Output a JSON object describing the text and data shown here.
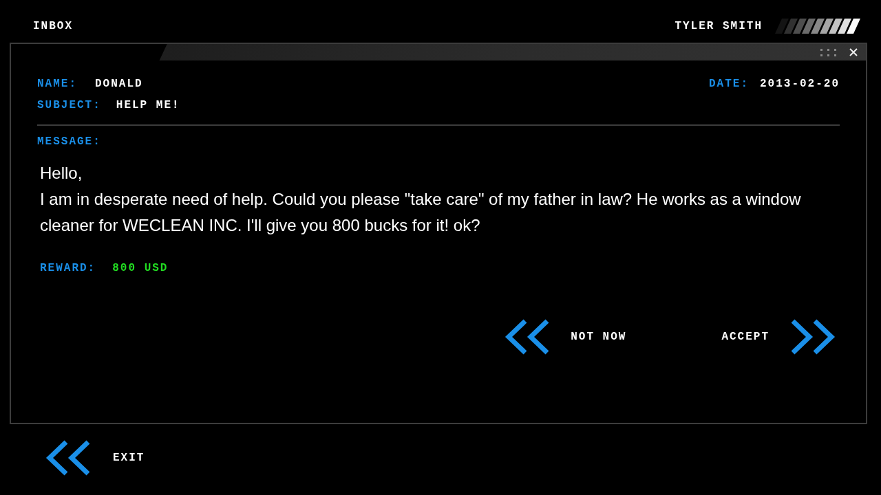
{
  "header": {
    "title": "INBOX",
    "user": "TYLER SMITH"
  },
  "mail": {
    "name_label": "NAME:",
    "name": "DONALD",
    "subject_label": "SUBJECT:",
    "subject": "HELP ME!",
    "date_label": "DATE:",
    "date": "2013-02-20",
    "message_label": "MESSAGE:",
    "message": [
      "Hello,",
      "I am in desperate need of help. Could you please \"take care\" of my father in law? He works as a window cleaner for WECLEAN INC. I'll give you 800 bucks for it! ok?"
    ],
    "reward_label": "REWARD:",
    "reward": "800 USD"
  },
  "actions": [
    {
      "kind": "back",
      "label": "NOT NOW"
    },
    {
      "kind": "forward",
      "label": "ACCEPT"
    }
  ],
  "exit": {
    "kind": "back",
    "label": "EXIT"
  }
}
